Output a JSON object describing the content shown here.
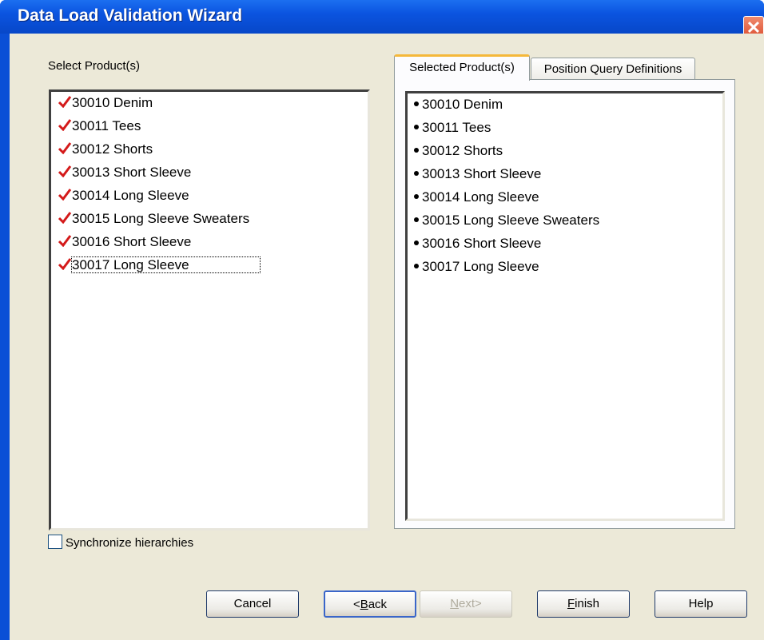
{
  "window": {
    "title": "Data Load Validation Wizard",
    "close_glyph": "✕"
  },
  "left": {
    "label": "Select Product(s)",
    "items": [
      {
        "label": "30010 Denim",
        "checked": true
      },
      {
        "label": "30011 Tees",
        "checked": true
      },
      {
        "label": "30012 Shorts",
        "checked": true
      },
      {
        "label": "30013 Short Sleeve",
        "checked": true
      },
      {
        "label": "30014 Long Sleeve",
        "checked": true
      },
      {
        "label": "30015 Long Sleeve Sweaters",
        "checked": true
      },
      {
        "label": "30016 Short Sleeve",
        "checked": true
      },
      {
        "label": "30017 Long Sleeve",
        "checked": true
      }
    ],
    "sync_label": "Synchronize hierarchies",
    "sync_checked": false
  },
  "tabs": [
    {
      "label": "Selected Product(s)",
      "active": true
    },
    {
      "label": "Position Query Definitions",
      "active": false
    }
  ],
  "right": {
    "items": [
      "30010 Denim",
      "30011 Tees",
      "30012 Shorts",
      "30013 Short Sleeve",
      "30014 Long Sleeve",
      "30015 Long Sleeve Sweaters",
      "30016 Short Sleeve",
      "30017 Long Sleeve"
    ]
  },
  "buttons": {
    "cancel": "Cancel",
    "back_prefix": "<",
    "back_mnemonic": "B",
    "back_rest": "ack",
    "next_mnemonic": "N",
    "next_rest": "ext>",
    "finish_mnemonic": "F",
    "finish_rest": "inish",
    "help": "Help"
  },
  "colors": {
    "check": "#d41a1a",
    "titlebar": "#0b54e0",
    "dialog_bg": "#ece9d8"
  }
}
